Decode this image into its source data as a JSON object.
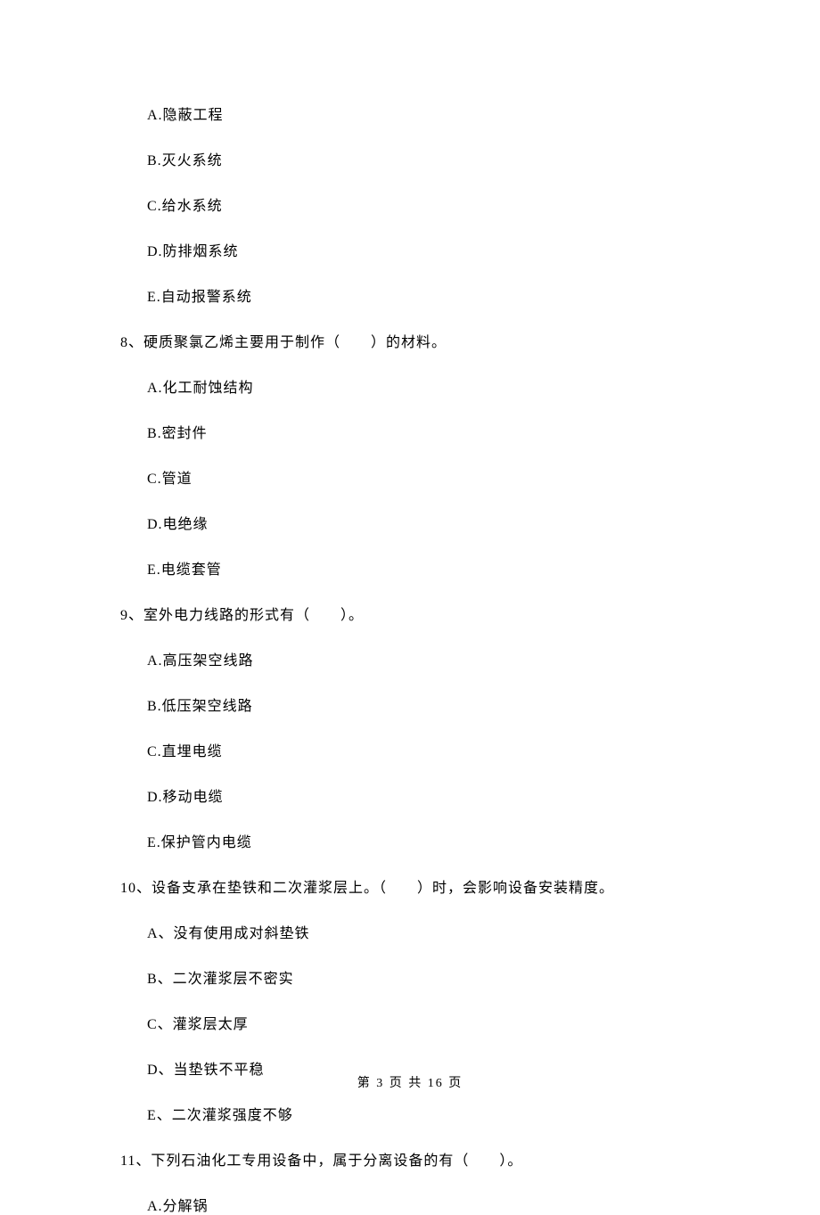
{
  "q7_options": {
    "a": "A.隐蔽工程",
    "b": "B.灭火系统",
    "c": "C.给水系统",
    "d": "D.防排烟系统",
    "e": "E.自动报警系统"
  },
  "q8": {
    "text": "8、硬质聚氯乙烯主要用于制作（　　）的材料。",
    "a": "A.化工耐蚀结构",
    "b": "B.密封件",
    "c": "C.管道",
    "d": "D.电绝缘",
    "e": "E.电缆套管"
  },
  "q9": {
    "text": "9、室外电力线路的形式有（　　）。",
    "a": "A.高压架空线路",
    "b": "B.低压架空线路",
    "c": "C.直埋电缆",
    "d": "D.移动电缆",
    "e": "E.保护管内电缆"
  },
  "q10": {
    "text": "10、设备支承在垫铁和二次灌浆层上。（　　）时，会影响设备安装精度。",
    "a": "A、没有使用成对斜垫铁",
    "b": "B、二次灌浆层不密实",
    "c": "C、灌浆层太厚",
    "d": "D、当垫铁不平稳",
    "e": "E、二次灌浆强度不够"
  },
  "q11": {
    "text": "11、下列石油化工专用设备中，属于分离设备的有（　　）。",
    "a": "A.分解锅"
  },
  "footer": "第 3 页 共 16 页"
}
